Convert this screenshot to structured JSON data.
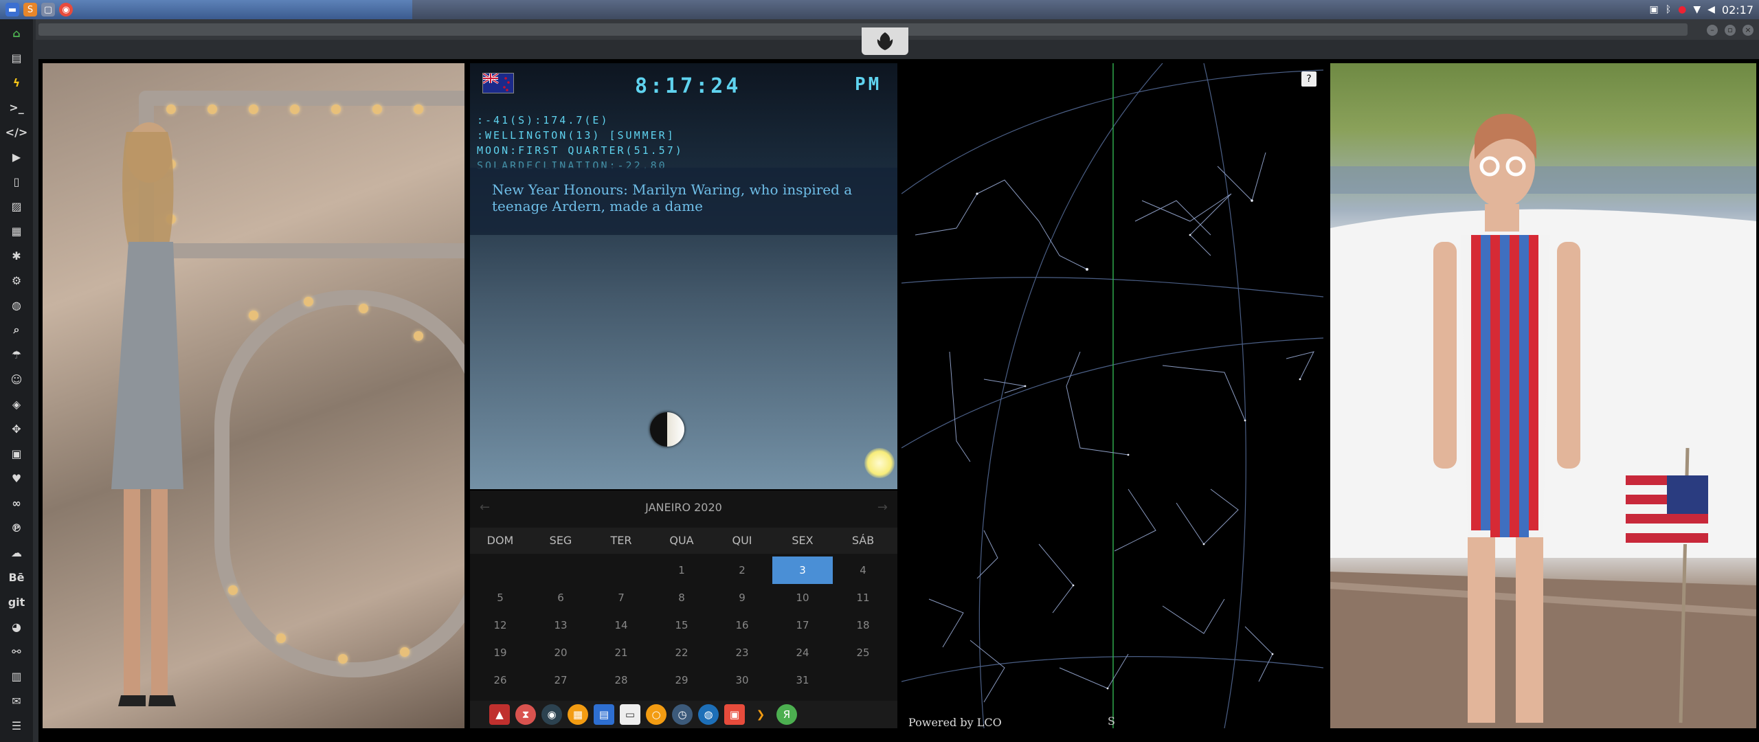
{
  "top_panel": {
    "time": "02:17",
    "apps": [
      "files-app",
      "sublime-app",
      "terminal-app",
      "chrome-app"
    ]
  },
  "dock": {
    "items": [
      "home",
      "file",
      "bolt",
      "terminal",
      "code",
      "play",
      "phone",
      "image",
      "news",
      "asterisk",
      "gear",
      "globe",
      "search",
      "umbrella",
      "contact",
      "tag",
      "expand",
      "youtube",
      "heart",
      "infinity",
      "pinterest",
      "cloud",
      "Bē",
      "git",
      "github",
      "share",
      "map",
      "mail",
      "list"
    ]
  },
  "clock": {
    "time": "8:17:24",
    "ampm": "PM",
    "lines": [
      ":-41(S):174.7(E)",
      ":WELLINGTON(13) [SUMMER]",
      "MOON:FIRST QUARTER(51.57)",
      "SOLARDECLINATION:-22.80"
    ],
    "news": "New Year Honours: Marilyn Waring, who inspired a teenage Ardern, made a dame"
  },
  "calendar": {
    "month_label": "JANEIRO 2020",
    "weekdays": [
      "DOM",
      "SEG",
      "TER",
      "QUA",
      "QUI",
      "SEX",
      "SÁB"
    ],
    "weeks": [
      [
        "",
        "",
        "",
        "1",
        "2",
        "3",
        "4"
      ],
      [
        "5",
        "6",
        "7",
        "8",
        "9",
        "10",
        "11"
      ],
      [
        "12",
        "13",
        "14",
        "15",
        "16",
        "17",
        "18"
      ],
      [
        "19",
        "20",
        "21",
        "22",
        "23",
        "24",
        "25"
      ],
      [
        "26",
        "27",
        "28",
        "29",
        "30",
        "31",
        ""
      ]
    ],
    "today": "3"
  },
  "starmap": {
    "help": "?",
    "powered": "Powered by LCO",
    "compass": "S"
  },
  "colors": {
    "accent": "#4a8fd6",
    "lcd": "#5fd3ef",
    "news": "#6fbfe8"
  }
}
